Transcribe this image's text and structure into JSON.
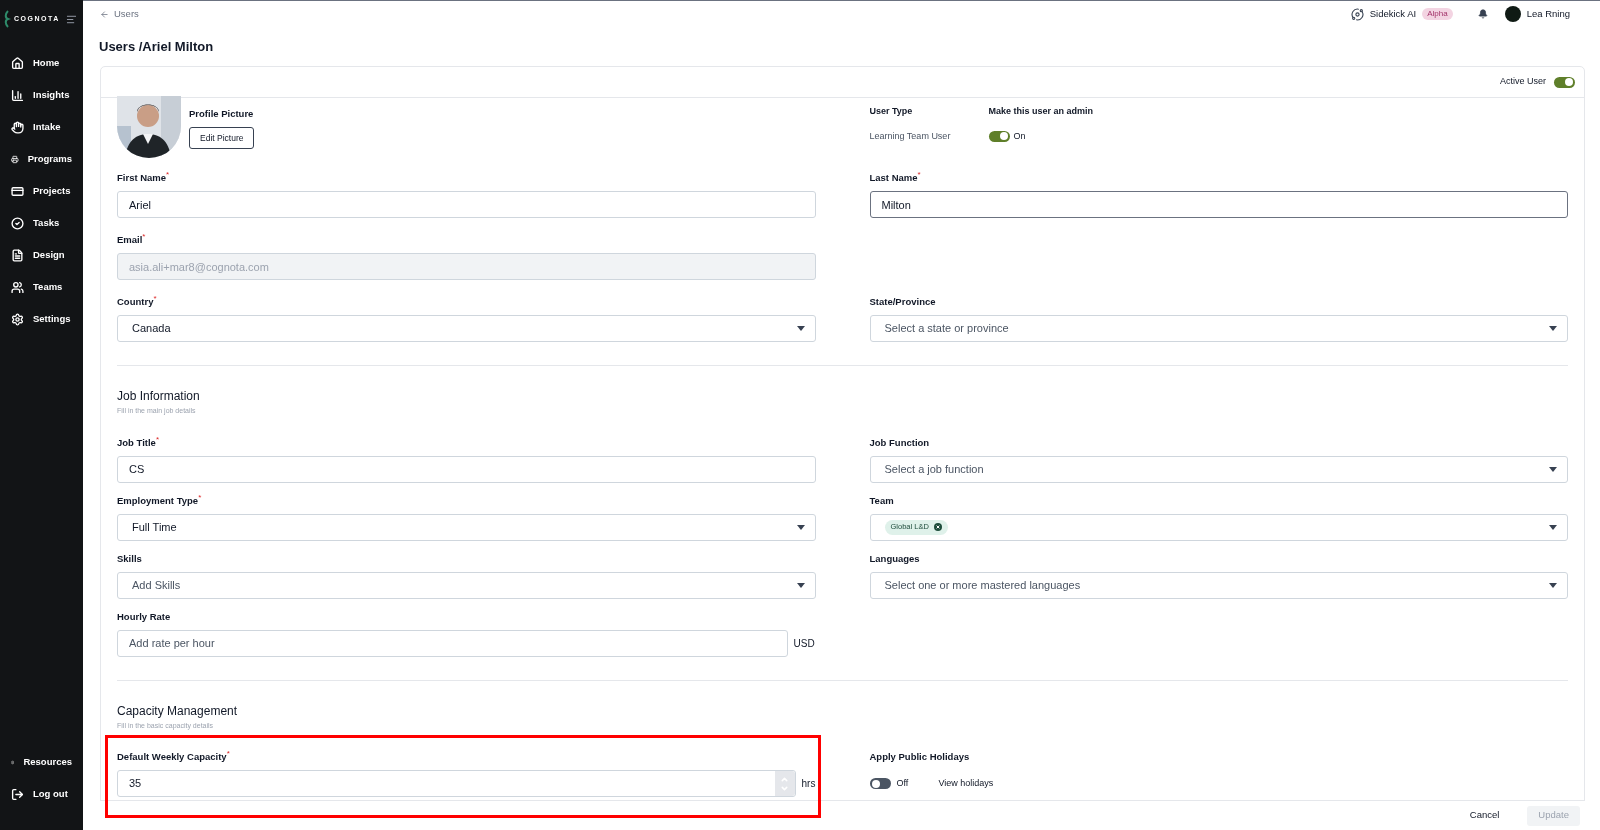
{
  "sidebar": {
    "logo": "COGNOTA",
    "items": [
      {
        "label": "Home"
      },
      {
        "label": "Insights"
      },
      {
        "label": "Intake"
      },
      {
        "label": "Programs"
      },
      {
        "label": "Projects"
      },
      {
        "label": "Tasks"
      },
      {
        "label": "Design"
      },
      {
        "label": "Teams"
      },
      {
        "label": "Settings"
      }
    ],
    "bottom_items": [
      {
        "label": "Resources"
      },
      {
        "label": "Log out"
      }
    ]
  },
  "topbar": {
    "back_link": "Users",
    "sidekick": "Sidekick AI",
    "badge": "Alpha",
    "user_name": "Lea Rning"
  },
  "page_title": "Users /Ariel Milton",
  "card": {
    "active_user": {
      "label": "Active User",
      "on": true
    },
    "profile": {
      "label": "Profile Picture",
      "button": "Edit Picture"
    },
    "user_type": {
      "label": "User Type",
      "value": "Learning Team User",
      "admin_label": "Make this user an admin",
      "admin_on": true,
      "admin_text": "On"
    },
    "sections": [
      {
        "rows": [
          {
            "left": {
              "kind": "text",
              "label": "First Name",
              "required_mark": "*",
              "value": "Ariel",
              "focused": false
            },
            "right": {
              "kind": "text",
              "label": "Last Name",
              "required_mark": "*",
              "value": "Milton",
              "focused": true
            }
          },
          {
            "left": {
              "kind": "readonly",
              "label": "Email",
              "required_mark": "*",
              "value": "asia.ali+mar8@cognota.com"
            }
          },
          {
            "left": {
              "kind": "select",
              "label": "Country",
              "required_mark": "*",
              "value": "Canada"
            },
            "right": {
              "kind": "select",
              "label": "State/Province",
              "placeholder": "Select a state or province"
            }
          }
        ]
      },
      {
        "title": "Job Information",
        "subtitle": "Fill in the main job details",
        "rows": [
          {
            "left": {
              "kind": "text",
              "label": "Job Title",
              "required_mark": "*",
              "value": "CS",
              "focused": false
            },
            "right": {
              "kind": "select",
              "label": "Job Function",
              "placeholder": "Select a job function"
            }
          },
          {
            "left": {
              "kind": "select",
              "label": "Employment Type",
              "required_mark": "*",
              "value": "Full Time"
            },
            "right": {
              "kind": "tags",
              "label": "Team",
              "tags": [
                "Global L&D"
              ]
            }
          },
          {
            "left": {
              "kind": "select",
              "label": "Skills",
              "placeholder": "Add Skills"
            },
            "right": {
              "kind": "select",
              "label": "Languages",
              "placeholder": "Select one or more mastered languages"
            }
          },
          {
            "left": {
              "kind": "text",
              "label": "Hourly Rate",
              "placeholder": "Add rate per hour",
              "suffix": "USD",
              "focused": false
            }
          }
        ]
      },
      {
        "title": "Capacity Management",
        "subtitle": "Fill in the basic capacity details",
        "rows": [
          {
            "left": {
              "kind": "number",
              "label": "Default Weekly Capacity",
              "required_mark": "*",
              "value": "35",
              "suffix": "hrs",
              "highlighted": true
            },
            "right": {
              "kind": "toggle",
              "label": "Apply Public Holidays",
              "on": false,
              "text": "Off",
              "link": "View holidays"
            }
          }
        ]
      }
    ]
  },
  "footer": {
    "cancel": "Cancel",
    "update": {
      "label": "Update",
      "disabled": true
    }
  }
}
